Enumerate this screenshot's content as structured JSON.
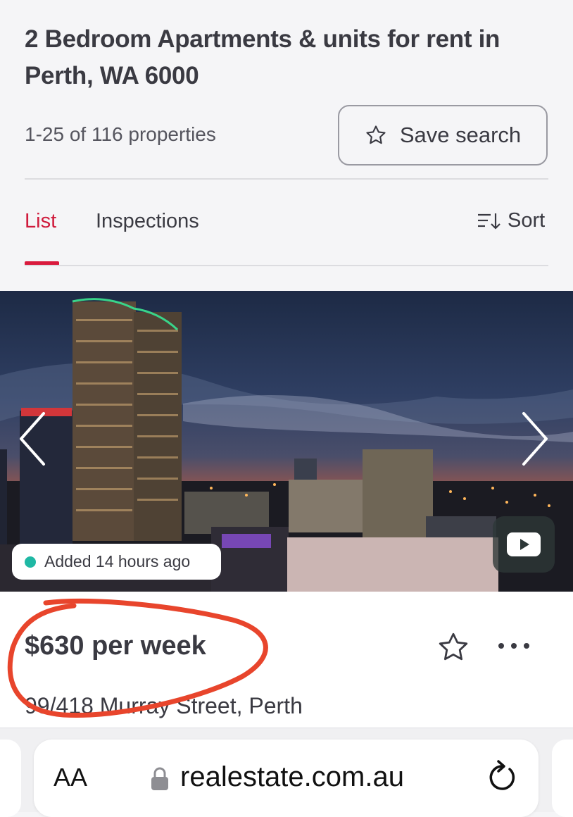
{
  "header": {
    "title": "2 Bedroom Apartments & units for rent in Perth, WA 6000",
    "result_count": "1-25 of 116 properties",
    "save_search_label": "Save search"
  },
  "tabs": {
    "items": [
      {
        "label": "List",
        "active": true
      },
      {
        "label": "Inspections",
        "active": false
      }
    ],
    "sort_label": "Sort"
  },
  "listing": {
    "badge": "Added 14 hours ago",
    "price": "$630 per week",
    "address": "99/418 Murray Street, Perth",
    "icons": [
      "chevron-left-icon",
      "chevron-right-icon",
      "play-icon",
      "star-icon",
      "more-icon"
    ]
  },
  "browser": {
    "text_size_label": "AA",
    "url": "realestate.com.au",
    "icons": [
      "lock-icon",
      "reload-icon"
    ]
  },
  "colors": {
    "accent": "#d91a3d",
    "badge_dot": "#1fb8a4",
    "annotation": "#e8452c"
  }
}
